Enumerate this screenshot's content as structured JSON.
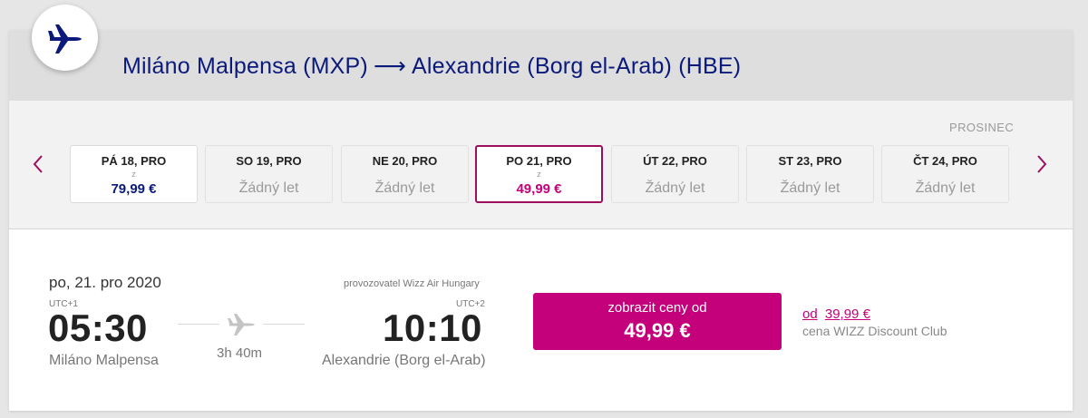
{
  "header": {
    "route_title_from": "Miláno Malpensa (MXP)",
    "route_title_arrow": "⟶",
    "route_title_to": "Alexandrie (Borg el-Arab) (HBE)"
  },
  "month_label": "PROSINEC",
  "dates": [
    {
      "day": "PÁ 18, PRO",
      "from": "z",
      "price": "79,99 €",
      "none": ""
    },
    {
      "day": "SO 19, PRO",
      "from": "",
      "price": "",
      "none": "Žádný let"
    },
    {
      "day": "NE 20, PRO",
      "from": "",
      "price": "",
      "none": "Žádný let"
    },
    {
      "day": "PO 21, PRO",
      "from": "z",
      "price": "49,99 €",
      "none": ""
    },
    {
      "day": "ÚT 22, PRO",
      "from": "",
      "price": "",
      "none": "Žádný let"
    },
    {
      "day": "ST 23, PRO",
      "from": "",
      "price": "",
      "none": "Žádný let"
    },
    {
      "day": "ČT 24, PRO",
      "from": "",
      "price": "",
      "none": "Žádný let"
    }
  ],
  "flight": {
    "date": "po, 21. pro 2020",
    "departure": {
      "tz": "UTC+1",
      "time": "05:30",
      "airport": "Miláno Malpensa"
    },
    "arrival": {
      "tz": "UTC+2",
      "time": "10:10",
      "airport": "Alexandrie (Borg el-Arab)"
    },
    "operator": "provozovatel Wizz Air Hungary",
    "duration": "3h 40m"
  },
  "cta": {
    "label": "zobrazit ceny od",
    "amount": "49,99 €"
  },
  "club": {
    "prefix": "od",
    "price": "39,99 €",
    "description": "cena WIZZ Discount Club"
  },
  "colors": {
    "brand_navy": "#0b1a7a",
    "brand_magenta": "#c4007a",
    "selected_border": "#9c0e5f"
  }
}
